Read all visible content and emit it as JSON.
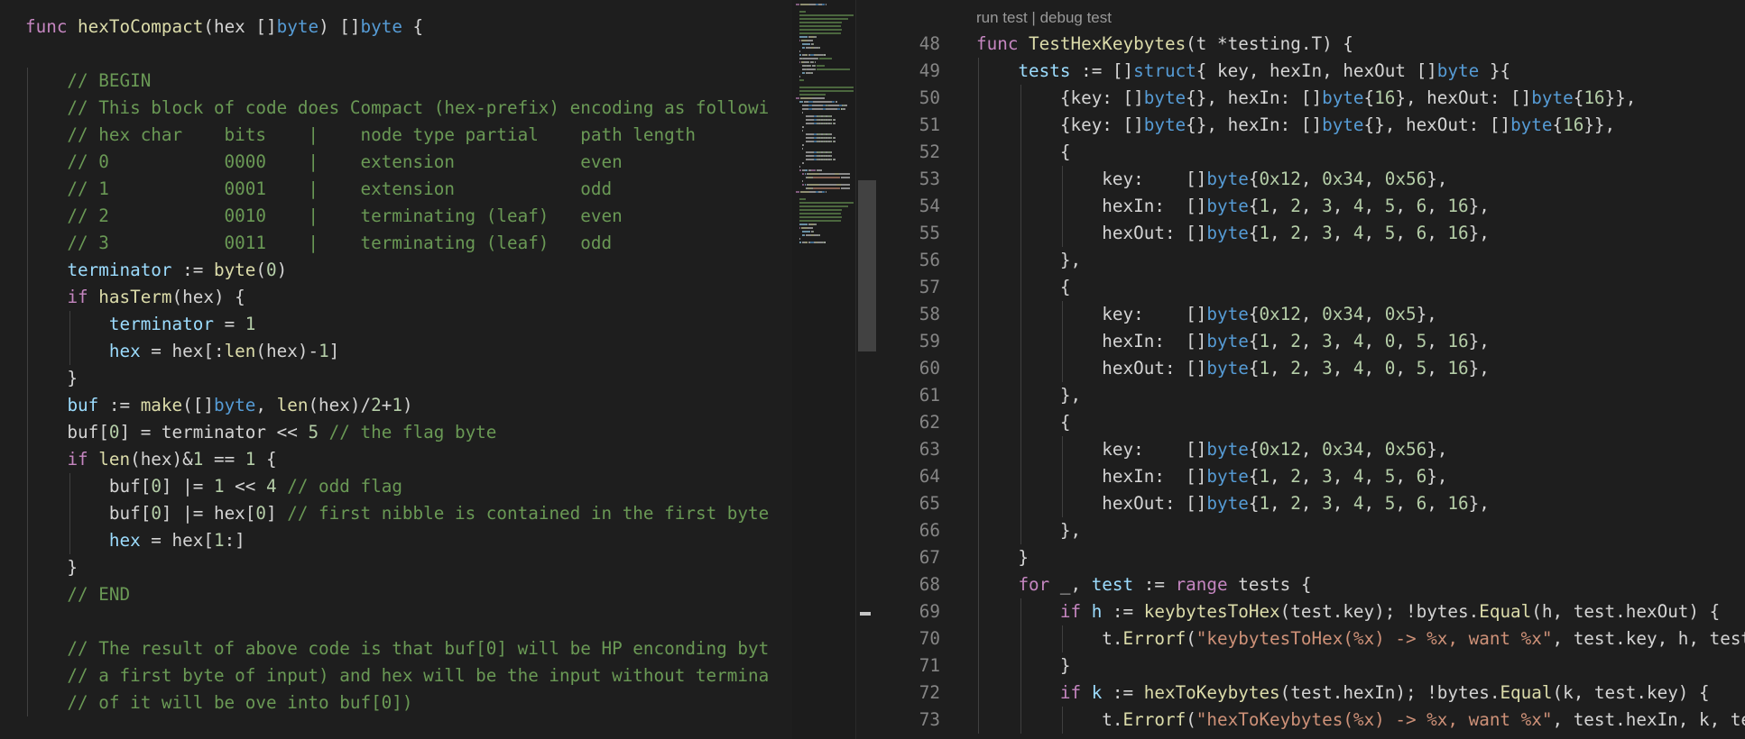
{
  "colors": {
    "keyword": "#c586c0",
    "function": "#dcdcaa",
    "type": "#569cd6",
    "number": "#b5cea8",
    "comment": "#6a9955",
    "string": "#ce9178",
    "variable": "#9cdcfe",
    "plain": "#d4d4d4",
    "line_number": "#858585",
    "background": "#1e1e1e"
  },
  "left_editor": {
    "lines": [
      [
        [
          "k",
          "func"
        ],
        [
          "p",
          " "
        ],
        [
          "f",
          "hexToCompact"
        ],
        [
          "p",
          "(hex []"
        ],
        [
          "t",
          "byte"
        ],
        [
          "p",
          ") []"
        ],
        [
          "t",
          "byte"
        ],
        [
          "p",
          " {"
        ]
      ],
      [],
      [
        [
          "c",
          "    // BEGIN"
        ]
      ],
      [
        [
          "c",
          "    // This block of code does Compact (hex-prefix) encoding as followi"
        ]
      ],
      [
        [
          "c",
          "    // hex char    bits    |    node type partial    path length"
        ]
      ],
      [
        [
          "c",
          "    // 0           0000    |    extension            even"
        ]
      ],
      [
        [
          "c",
          "    // 1           0001    |    extension            odd"
        ]
      ],
      [
        [
          "c",
          "    // 2           0010    |    terminating (leaf)   even"
        ]
      ],
      [
        [
          "c",
          "    // 3           0011    |    terminating (leaf)   odd"
        ]
      ],
      [
        [
          "p",
          "    "
        ],
        [
          "v",
          "terminator"
        ],
        [
          "p",
          " := "
        ],
        [
          "f",
          "byte"
        ],
        [
          "p",
          "("
        ],
        [
          "n",
          "0"
        ],
        [
          "p",
          ")"
        ]
      ],
      [
        [
          "p",
          "    "
        ],
        [
          "k",
          "if"
        ],
        [
          "p",
          " "
        ],
        [
          "f",
          "hasTerm"
        ],
        [
          "p",
          "(hex) {"
        ]
      ],
      [
        [
          "p",
          "        "
        ],
        [
          "v",
          "terminator"
        ],
        [
          "p",
          " = "
        ],
        [
          "n",
          "1"
        ]
      ],
      [
        [
          "p",
          "        "
        ],
        [
          "v",
          "hex"
        ],
        [
          "p",
          " = hex[:"
        ],
        [
          "f",
          "len"
        ],
        [
          "p",
          "(hex)-"
        ],
        [
          "n",
          "1"
        ],
        [
          "p",
          "]"
        ]
      ],
      [
        [
          "p",
          "    }"
        ]
      ],
      [
        [
          "p",
          "    "
        ],
        [
          "v",
          "buf"
        ],
        [
          "p",
          " := "
        ],
        [
          "f",
          "make"
        ],
        [
          "p",
          "([]"
        ],
        [
          "t",
          "byte"
        ],
        [
          "p",
          ", "
        ],
        [
          "f",
          "len"
        ],
        [
          "p",
          "(hex)/"
        ],
        [
          "n",
          "2"
        ],
        [
          "p",
          "+"
        ],
        [
          "n",
          "1"
        ],
        [
          "p",
          ")"
        ]
      ],
      [
        [
          "p",
          "    buf["
        ],
        [
          "n",
          "0"
        ],
        [
          "p",
          "] = terminator << "
        ],
        [
          "n",
          "5"
        ],
        [
          "p",
          " "
        ],
        [
          "c",
          "// the flag byte"
        ]
      ],
      [
        [
          "p",
          "    "
        ],
        [
          "k",
          "if"
        ],
        [
          "p",
          " "
        ],
        [
          "f",
          "len"
        ],
        [
          "p",
          "(hex)&"
        ],
        [
          "n",
          "1"
        ],
        [
          "p",
          " == "
        ],
        [
          "n",
          "1"
        ],
        [
          "p",
          " {"
        ]
      ],
      [
        [
          "p",
          "        buf["
        ],
        [
          "n",
          "0"
        ],
        [
          "p",
          "] |= "
        ],
        [
          "n",
          "1"
        ],
        [
          "p",
          " << "
        ],
        [
          "n",
          "4"
        ],
        [
          "p",
          " "
        ],
        [
          "c",
          "// odd flag"
        ]
      ],
      [
        [
          "p",
          "        buf["
        ],
        [
          "n",
          "0"
        ],
        [
          "p",
          "] |= hex["
        ],
        [
          "n",
          "0"
        ],
        [
          "p",
          "] "
        ],
        [
          "c",
          "// first nibble is contained in the first byte"
        ]
      ],
      [
        [
          "p",
          "        "
        ],
        [
          "v",
          "hex"
        ],
        [
          "p",
          " = hex["
        ],
        [
          "n",
          "1"
        ],
        [
          "p",
          ":]"
        ]
      ],
      [
        [
          "p",
          "    }"
        ]
      ],
      [
        [
          "c",
          "    // END"
        ]
      ],
      [],
      [
        [
          "c",
          "    // The result of above code is that buf[0] will be HP enconding byt"
        ]
      ],
      [
        [
          "c",
          "    // a first byte of input) and hex will be the input without termina"
        ]
      ],
      [
        [
          "c",
          "    // of it will be ove into buf[0])"
        ]
      ]
    ]
  },
  "right_editor": {
    "codelens": {
      "run": "run test",
      "sep": " | ",
      "debug": "debug test"
    },
    "line_numbers": [
      "48",
      "49",
      "50",
      "51",
      "52",
      "53",
      "54",
      "55",
      "56",
      "57",
      "58",
      "59",
      "60",
      "61",
      "62",
      "63",
      "64",
      "65",
      "66",
      "67",
      "68",
      "69",
      "70",
      "71",
      "72",
      "73"
    ],
    "lines": [
      [
        [
          "k",
          "func"
        ],
        [
          "p",
          " "
        ],
        [
          "f",
          "TestHexKeybytes"
        ],
        [
          "p",
          "(t *testing.T) {"
        ]
      ],
      [
        [
          "p",
          "    "
        ],
        [
          "v",
          "tests"
        ],
        [
          "p",
          " := []"
        ],
        [
          "t",
          "struct"
        ],
        [
          "p",
          "{ key, hexIn, hexOut []"
        ],
        [
          "t",
          "byte"
        ],
        [
          "p",
          " }{"
        ]
      ],
      [
        [
          "p",
          "        {key: []"
        ],
        [
          "t",
          "byte"
        ],
        [
          "p",
          "{}, hexIn: []"
        ],
        [
          "t",
          "byte"
        ],
        [
          "p",
          "{"
        ],
        [
          "n",
          "16"
        ],
        [
          "p",
          "}, hexOut: []"
        ],
        [
          "t",
          "byte"
        ],
        [
          "p",
          "{"
        ],
        [
          "n",
          "16"
        ],
        [
          "p",
          "}},"
        ]
      ],
      [
        [
          "p",
          "        {key: []"
        ],
        [
          "t",
          "byte"
        ],
        [
          "p",
          "{}, hexIn: []"
        ],
        [
          "t",
          "byte"
        ],
        [
          "p",
          "{}, hexOut: []"
        ],
        [
          "t",
          "byte"
        ],
        [
          "p",
          "{"
        ],
        [
          "n",
          "16"
        ],
        [
          "p",
          "}},"
        ]
      ],
      [
        [
          "p",
          "        {"
        ]
      ],
      [
        [
          "p",
          "            key:    []"
        ],
        [
          "t",
          "byte"
        ],
        [
          "p",
          "{"
        ],
        [
          "n",
          "0x12"
        ],
        [
          "p",
          ", "
        ],
        [
          "n",
          "0x34"
        ],
        [
          "p",
          ", "
        ],
        [
          "n",
          "0x56"
        ],
        [
          "p",
          "},"
        ]
      ],
      [
        [
          "p",
          "            hexIn:  []"
        ],
        [
          "t",
          "byte"
        ],
        [
          "p",
          "{"
        ],
        [
          "n",
          "1"
        ],
        [
          "p",
          ", "
        ],
        [
          "n",
          "2"
        ],
        [
          "p",
          ", "
        ],
        [
          "n",
          "3"
        ],
        [
          "p",
          ", "
        ],
        [
          "n",
          "4"
        ],
        [
          "p",
          ", "
        ],
        [
          "n",
          "5"
        ],
        [
          "p",
          ", "
        ],
        [
          "n",
          "6"
        ],
        [
          "p",
          ", "
        ],
        [
          "n",
          "16"
        ],
        [
          "p",
          "},"
        ]
      ],
      [
        [
          "p",
          "            hexOut: []"
        ],
        [
          "t",
          "byte"
        ],
        [
          "p",
          "{"
        ],
        [
          "n",
          "1"
        ],
        [
          "p",
          ", "
        ],
        [
          "n",
          "2"
        ],
        [
          "p",
          ", "
        ],
        [
          "n",
          "3"
        ],
        [
          "p",
          ", "
        ],
        [
          "n",
          "4"
        ],
        [
          "p",
          ", "
        ],
        [
          "n",
          "5"
        ],
        [
          "p",
          ", "
        ],
        [
          "n",
          "6"
        ],
        [
          "p",
          ", "
        ],
        [
          "n",
          "16"
        ],
        [
          "p",
          "},"
        ]
      ],
      [
        [
          "p",
          "        },"
        ]
      ],
      [
        [
          "p",
          "        {"
        ]
      ],
      [
        [
          "p",
          "            key:    []"
        ],
        [
          "t",
          "byte"
        ],
        [
          "p",
          "{"
        ],
        [
          "n",
          "0x12"
        ],
        [
          "p",
          ", "
        ],
        [
          "n",
          "0x34"
        ],
        [
          "p",
          ", "
        ],
        [
          "n",
          "0x5"
        ],
        [
          "p",
          "},"
        ]
      ],
      [
        [
          "p",
          "            hexIn:  []"
        ],
        [
          "t",
          "byte"
        ],
        [
          "p",
          "{"
        ],
        [
          "n",
          "1"
        ],
        [
          "p",
          ", "
        ],
        [
          "n",
          "2"
        ],
        [
          "p",
          ", "
        ],
        [
          "n",
          "3"
        ],
        [
          "p",
          ", "
        ],
        [
          "n",
          "4"
        ],
        [
          "p",
          ", "
        ],
        [
          "n",
          "0"
        ],
        [
          "p",
          ", "
        ],
        [
          "n",
          "5"
        ],
        [
          "p",
          ", "
        ],
        [
          "n",
          "16"
        ],
        [
          "p",
          "},"
        ]
      ],
      [
        [
          "p",
          "            hexOut: []"
        ],
        [
          "t",
          "byte"
        ],
        [
          "p",
          "{"
        ],
        [
          "n",
          "1"
        ],
        [
          "p",
          ", "
        ],
        [
          "n",
          "2"
        ],
        [
          "p",
          ", "
        ],
        [
          "n",
          "3"
        ],
        [
          "p",
          ", "
        ],
        [
          "n",
          "4"
        ],
        [
          "p",
          ", "
        ],
        [
          "n",
          "0"
        ],
        [
          "p",
          ", "
        ],
        [
          "n",
          "5"
        ],
        [
          "p",
          ", "
        ],
        [
          "n",
          "16"
        ],
        [
          "p",
          "},"
        ]
      ],
      [
        [
          "p",
          "        },"
        ]
      ],
      [
        [
          "p",
          "        {"
        ]
      ],
      [
        [
          "p",
          "            key:    []"
        ],
        [
          "t",
          "byte"
        ],
        [
          "p",
          "{"
        ],
        [
          "n",
          "0x12"
        ],
        [
          "p",
          ", "
        ],
        [
          "n",
          "0x34"
        ],
        [
          "p",
          ", "
        ],
        [
          "n",
          "0x56"
        ],
        [
          "p",
          "},"
        ]
      ],
      [
        [
          "p",
          "            hexIn:  []"
        ],
        [
          "t",
          "byte"
        ],
        [
          "p",
          "{"
        ],
        [
          "n",
          "1"
        ],
        [
          "p",
          ", "
        ],
        [
          "n",
          "2"
        ],
        [
          "p",
          ", "
        ],
        [
          "n",
          "3"
        ],
        [
          "p",
          ", "
        ],
        [
          "n",
          "4"
        ],
        [
          "p",
          ", "
        ],
        [
          "n",
          "5"
        ],
        [
          "p",
          ", "
        ],
        [
          "n",
          "6"
        ],
        [
          "p",
          "},"
        ]
      ],
      [
        [
          "p",
          "            hexOut: []"
        ],
        [
          "t",
          "byte"
        ],
        [
          "p",
          "{"
        ],
        [
          "n",
          "1"
        ],
        [
          "p",
          ", "
        ],
        [
          "n",
          "2"
        ],
        [
          "p",
          ", "
        ],
        [
          "n",
          "3"
        ],
        [
          "p",
          ", "
        ],
        [
          "n",
          "4"
        ],
        [
          "p",
          ", "
        ],
        [
          "n",
          "5"
        ],
        [
          "p",
          ", "
        ],
        [
          "n",
          "6"
        ],
        [
          "p",
          ", "
        ],
        [
          "n",
          "16"
        ],
        [
          "p",
          "},"
        ]
      ],
      [
        [
          "p",
          "        },"
        ]
      ],
      [
        [
          "p",
          "    }"
        ]
      ],
      [
        [
          "p",
          "    "
        ],
        [
          "k",
          "for"
        ],
        [
          "p",
          " _, "
        ],
        [
          "v",
          "test"
        ],
        [
          "p",
          " := "
        ],
        [
          "k",
          "range"
        ],
        [
          "p",
          " tests {"
        ]
      ],
      [
        [
          "p",
          "        "
        ],
        [
          "k",
          "if"
        ],
        [
          "p",
          " "
        ],
        [
          "v",
          "h"
        ],
        [
          "p",
          " := "
        ],
        [
          "f",
          "keybytesToHex"
        ],
        [
          "p",
          "(test.key); !bytes."
        ],
        [
          "f",
          "Equal"
        ],
        [
          "p",
          "(h, test.hexOut) {"
        ]
      ],
      [
        [
          "p",
          "            t."
        ],
        [
          "f",
          "Errorf"
        ],
        [
          "p",
          "("
        ],
        [
          "s",
          "\"keybytesToHex(%x) -> %x, want %x\""
        ],
        [
          "p",
          ", test.key, h, test.hexOut)"
        ]
      ],
      [
        [
          "p",
          "        }"
        ]
      ],
      [
        [
          "p",
          "        "
        ],
        [
          "k",
          "if"
        ],
        [
          "p",
          " "
        ],
        [
          "v",
          "k"
        ],
        [
          "p",
          " := "
        ],
        [
          "f",
          "hexToKeybytes"
        ],
        [
          "p",
          "(test.hexIn); !bytes."
        ],
        [
          "f",
          "Equal"
        ],
        [
          "p",
          "(k, test.key) {"
        ]
      ],
      [
        [
          "p",
          "            t."
        ],
        [
          "f",
          "Errorf"
        ],
        [
          "p",
          "("
        ],
        [
          "s",
          "\"hexToKeybytes(%x) -> %x, want %x\""
        ],
        [
          "p",
          ", test.hexIn, k, test.key)"
        ]
      ]
    ]
  }
}
